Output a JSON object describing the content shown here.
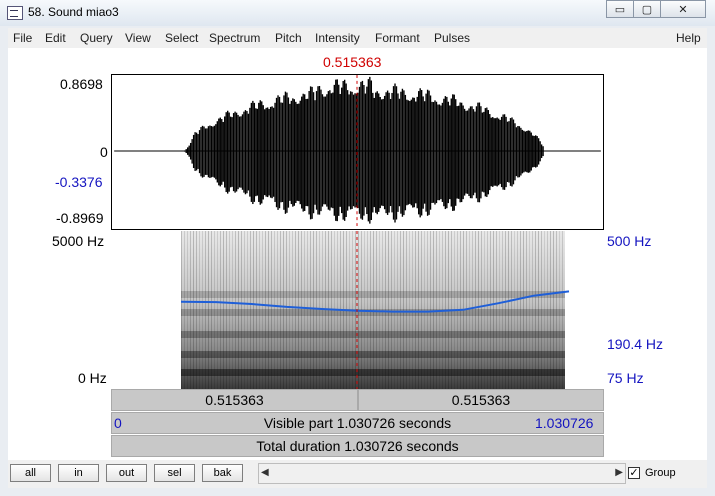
{
  "window": {
    "title": "58. Sound miao3",
    "minimize_glyph": "▭",
    "maximize_glyph": "▢",
    "close_glyph": "✕"
  },
  "menu": [
    "File",
    "Edit",
    "Query",
    "View",
    "Select",
    "Spectrum",
    "Pitch",
    "Intensity",
    "Formant",
    "Pulses",
    "Help"
  ],
  "cursor": {
    "time_label": "0.515363",
    "time_fraction": 0.5
  },
  "waveform": {
    "y_max": "0.8698",
    "y_zero": "0",
    "y_cursor": "-0.3376",
    "y_min": "-0.8969"
  },
  "spectrogram": {
    "freq_max": "5000 Hz",
    "freq_min": "0 Hz",
    "pitch_max": "500 Hz",
    "pitch_cursor": "190.4 Hz",
    "pitch_min": "75 Hz"
  },
  "pitch_contour_hz": [
    214,
    213,
    208,
    201,
    196,
    192,
    190,
    190,
    194,
    210,
    230,
    242
  ],
  "time_bars": {
    "left_half": "0.515363",
    "right_half": "0.515363",
    "visible_start": "0",
    "visible_part": "Visible part 1.030726 seconds",
    "visible_end": "1.030726",
    "total_duration": "Total duration 1.030726 seconds"
  },
  "bottom_buttons": [
    "all",
    "in",
    "out",
    "sel",
    "bak"
  ],
  "scroll": {
    "left_arrow": "◀",
    "right_arrow": "▶"
  },
  "group": {
    "label": "Group",
    "checked": true,
    "check_glyph": "✓"
  },
  "colors": {
    "pitch_line": "#1f5fd8",
    "cursor": "#d00000",
    "label_blue": "#1414c0"
  }
}
